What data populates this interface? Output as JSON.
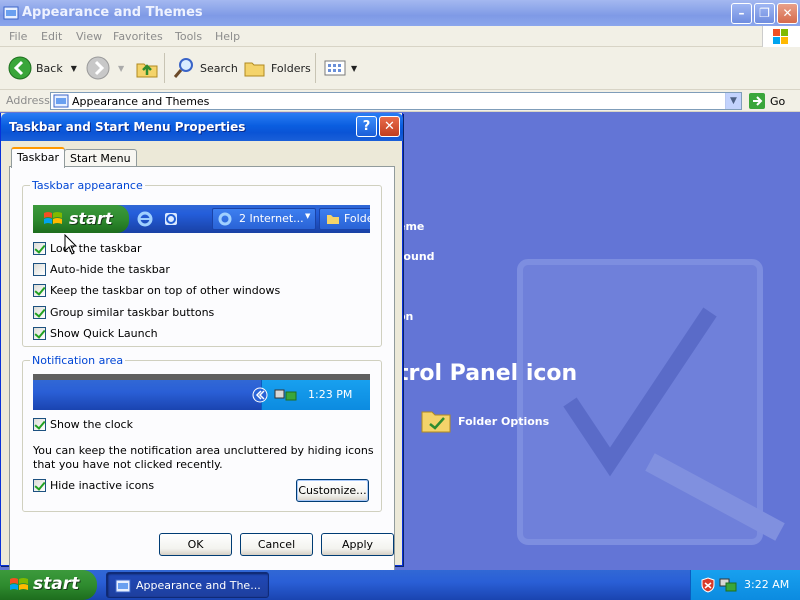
{
  "explorer": {
    "title": "Appearance and Themes",
    "menu": [
      "File",
      "Edit",
      "View",
      "Favorites",
      "Tools",
      "Help"
    ],
    "toolbar": {
      "back": "Back",
      "search": "Search",
      "folders": "Folders"
    },
    "address": {
      "label": "Address",
      "value": "Appearance and Themes",
      "go": "Go"
    },
    "content": {
      "links": [
        "eme",
        "round",
        "on"
      ],
      "heading": "trol Panel icon",
      "folder_options": "Folder Options"
    }
  },
  "dialog": {
    "title": "Taskbar and Start Menu Properties",
    "tabs": [
      "Taskbar",
      "Start Menu"
    ],
    "taskbar_group": {
      "label": "Taskbar appearance",
      "preview_start": "start",
      "preview_task": "2 Internet...",
      "preview_task2": "Folde",
      "options": [
        {
          "label": "Lock the taskbar",
          "checked": true
        },
        {
          "label": "Auto-hide the taskbar",
          "checked": false
        },
        {
          "label": "Keep the taskbar on top of other windows",
          "checked": true
        },
        {
          "label": "Group similar taskbar buttons",
          "checked": true
        },
        {
          "label": "Show Quick Launch",
          "checked": true
        }
      ]
    },
    "notification_group": {
      "label": "Notification area",
      "preview_time": "1:23 PM",
      "show_clock": {
        "label": "Show the clock",
        "checked": true
      },
      "note": "You can keep the notification area uncluttered by hiding icons that you have not clicked recently.",
      "hide_inactive": {
        "label": "Hide inactive icons",
        "checked": true
      },
      "customize": "Customize..."
    },
    "buttons": {
      "ok": "OK",
      "cancel": "Cancel",
      "apply": "Apply"
    }
  },
  "taskbar": {
    "start": "start",
    "task": "Appearance and The...",
    "clock": "3:22 AM"
  }
}
